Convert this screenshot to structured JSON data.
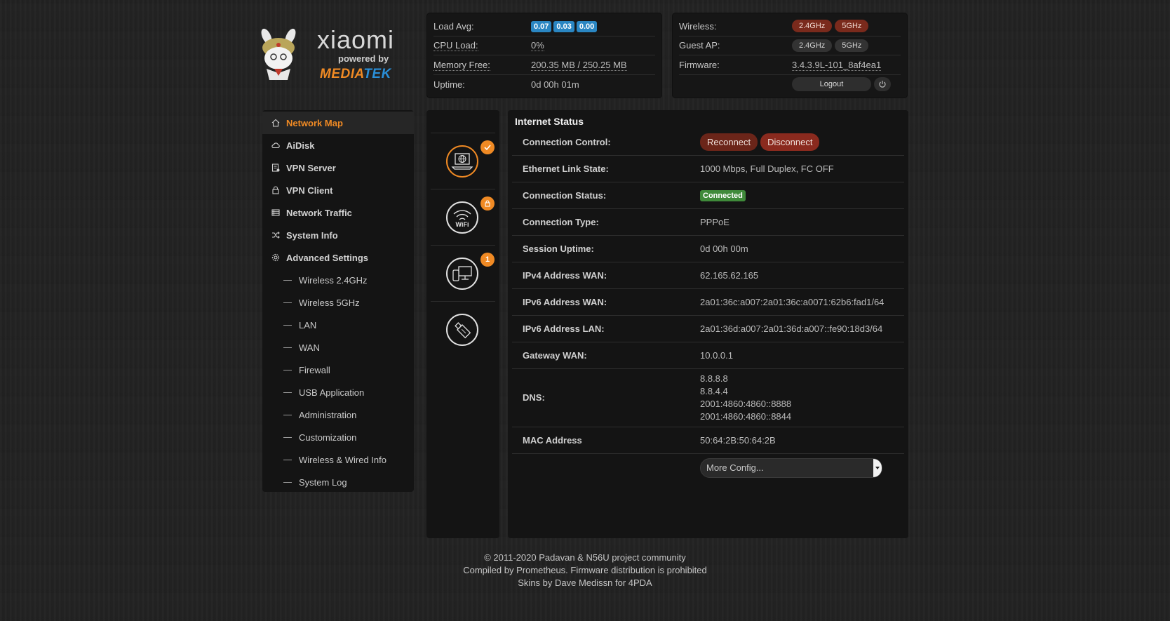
{
  "logo": {
    "brand": "xiaomi",
    "powered": "powered by",
    "mediatek_a": "MEDIA",
    "mediatek_b": "TEK"
  },
  "system": {
    "load_avg_label": "Load Avg:",
    "load_avg": [
      "0.07",
      "0.03",
      "0.00"
    ],
    "cpu_label": "CPU Load:",
    "cpu_value": "0%",
    "mem_label": "Memory Free:",
    "mem_value": "200.35 MB / 250.25 MB",
    "uptime_label": "Uptime:",
    "uptime_value": "0d 00h 01m"
  },
  "wireless": {
    "wireless_label": "Wireless:",
    "wireless_bands": [
      "2.4GHz",
      "5GHz"
    ],
    "guest_label": "Guest AP:",
    "guest_bands": [
      "2.4GHz",
      "5GHz"
    ],
    "firmware_label": "Firmware:",
    "firmware_value": "3.4.3.9L-101_8af4ea1",
    "logout_label": "Logout"
  },
  "sidebar": {
    "items": [
      {
        "label": "Network Map",
        "icon": "home-icon",
        "active": true
      },
      {
        "label": "AiDisk",
        "icon": "cloud-icon"
      },
      {
        "label": "VPN Server",
        "icon": "document-icon"
      },
      {
        "label": "VPN Client",
        "icon": "lock-icon"
      },
      {
        "label": "Network Traffic",
        "icon": "list-icon"
      },
      {
        "label": "System Info",
        "icon": "shuffle-icon"
      },
      {
        "label": "Advanced Settings",
        "icon": "gear-icon"
      }
    ],
    "sub_items": [
      "Wireless 2.4GHz",
      "Wireless 5GHz",
      "LAN",
      "WAN",
      "Firewall",
      "USB Application",
      "Administration",
      "Customization",
      "Wireless & Wired Info",
      "System Log"
    ]
  },
  "icon_column": {
    "badges": {
      "wifi_label": "WiFi",
      "clients_count": "1"
    },
    "icons": [
      "internet-icon",
      "wifi-icon",
      "clients-icon",
      "usb-icon"
    ]
  },
  "main": {
    "title": "Internet Status",
    "connection_control_label": "Connection Control:",
    "reconnect_label": "Reconnect",
    "disconnect_label": "Disconnect",
    "rows": [
      {
        "key": "Ethernet Link State:",
        "value": "1000 Mbps, Full Duplex, FC OFF"
      },
      {
        "key": "Connection Status:",
        "value": "Connected",
        "badge": true
      },
      {
        "key": "Connection Type:",
        "value": "PPPoE"
      },
      {
        "key": "Session Uptime:",
        "value": "0d 00h 00m"
      },
      {
        "key": "IPv4 Address WAN:",
        "value": "62.165.62.165"
      },
      {
        "key": "IPv6 Address WAN:",
        "value": "2a01:36c:a007:2a01:36c:a0071:62b6:fad1/64"
      },
      {
        "key": "IPv6 Address LAN:",
        "value": "2a01:36d:a007:2a01:36d:a007::fe90:18d3/64"
      },
      {
        "key": "Gateway WAN:",
        "value": "10.0.0.1"
      }
    ],
    "dns_label": "DNS:",
    "dns": [
      "8.8.8.8",
      "8.8.4.4",
      "2001:4860:4860::8888",
      "2001:4860:4860::8844"
    ],
    "mac_label": "MAC Address",
    "mac_value": "50:64:2B:50:64:2B",
    "more_config": "More Config..."
  },
  "footer": {
    "line1": "© 2011-2020 Padavan & N56U project community",
    "line2": "Compiled by Prometheus. Firmware distribution is prohibited",
    "line3": "Skins by Dave Medissn for 4PDA"
  },
  "colors": {
    "accent": "#f08a24",
    "blue": "#2a86c2",
    "green": "#3f8a3a",
    "red": "#6b2519"
  }
}
